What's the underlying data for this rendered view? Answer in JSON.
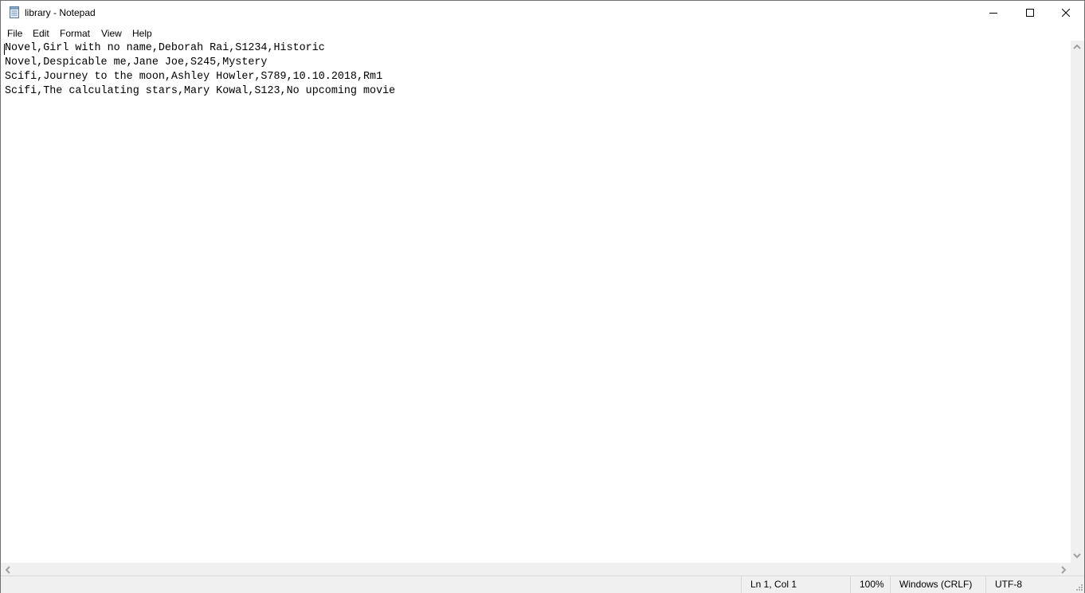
{
  "window": {
    "title": "library - Notepad",
    "app_icon": "notepad-icon",
    "controls": {
      "minimize": "minimize-icon",
      "maximize": "maximize-icon",
      "close": "close-icon"
    }
  },
  "menu": {
    "items": [
      {
        "label": "File"
      },
      {
        "label": "Edit"
      },
      {
        "label": "Format"
      },
      {
        "label": "View"
      },
      {
        "label": "Help"
      }
    ]
  },
  "editor": {
    "lines": [
      "Novel,Girl with no name,Deborah Rai,S1234,Historic",
      "Novel,Despicable me,Jane Joe,S245,Mystery",
      "Scifi,Journey to the moon,Ashley Howler,S789,10.10.2018,Rm1",
      "Scifi,The calculating stars,Mary Kowal,S123,No upcoming movie"
    ]
  },
  "statusbar": {
    "position": "Ln 1, Col 1",
    "zoom": "100%",
    "line_ending": "Windows (CRLF)",
    "encoding": "UTF-8"
  },
  "scrollbars": {
    "up": "▲",
    "down": "▼",
    "left": "◀",
    "right": "▶"
  }
}
